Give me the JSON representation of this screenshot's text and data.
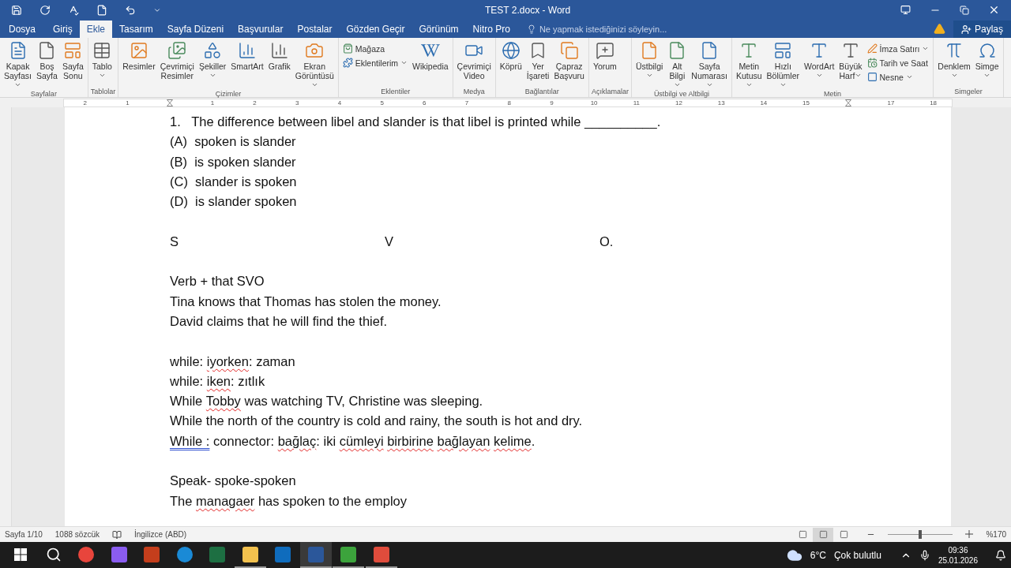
{
  "window": {
    "title": "TEST 2.docx - Word"
  },
  "tabs": [
    {
      "label": "Dosya",
      "selected": false
    },
    {
      "label": "Giriş",
      "selected": false
    },
    {
      "label": "Ekle",
      "selected": true
    },
    {
      "label": "Tasarım",
      "selected": false
    },
    {
      "label": "Sayfa Düzeni",
      "selected": false
    },
    {
      "label": "Başvurular",
      "selected": false
    },
    {
      "label": "Postalar",
      "selected": false
    },
    {
      "label": "Gözden Geçir",
      "selected": false
    },
    {
      "label": "Görünüm",
      "selected": false
    },
    {
      "label": "Nitro Pro",
      "selected": false
    }
  ],
  "tell_me": {
    "placeholder": "Ne yapmak istediğinizi söyleyin..."
  },
  "share": "Paylaş",
  "ribbon": {
    "groups": [
      {
        "label": "Sayfalar",
        "items": [
          {
            "kind": "large",
            "lines": [
              "Kapak",
              "Sayfası"
            ],
            "dropdown": true
          },
          {
            "kind": "large",
            "lines": [
              "Boş",
              "Sayfa"
            ],
            "dropdown": false
          },
          {
            "kind": "large",
            "lines": [
              "Sayfa",
              "Sonu"
            ],
            "dropdown": false
          }
        ]
      },
      {
        "label": "Tablolar",
        "items": [
          {
            "kind": "large",
            "lines": [
              "Tablo"
            ],
            "dropdown": true
          }
        ]
      },
      {
        "label": "Çizimler",
        "items": [
          {
            "kind": "large",
            "lines": [
              "Resimler"
            ],
            "dropdown": false
          },
          {
            "kind": "large",
            "lines": [
              "Çevrimiçi",
              "Resimler"
            ],
            "dropdown": false
          },
          {
            "kind": "large",
            "lines": [
              "Şekiller"
            ],
            "dropdown": true
          },
          {
            "kind": "large",
            "lines": [
              "SmartArt"
            ],
            "dropdown": false
          },
          {
            "kind": "large",
            "lines": [
              "Grafik"
            ],
            "dropdown": false
          },
          {
            "kind": "large",
            "lines": [
              "Ekran",
              "Görüntüsü"
            ],
            "dropdown": true
          }
        ]
      },
      {
        "label": "Eklentiler",
        "items": [
          {
            "kind": "small",
            "lines": [
              "Mağaza"
            ],
            "dropdown": false
          },
          {
            "kind": "small",
            "lines": [
              "Eklentilerim"
            ],
            "dropdown": true
          },
          {
            "kind": "large",
            "lines": [
              "Wikipedia"
            ],
            "dropdown": false
          }
        ]
      },
      {
        "label": "Medya",
        "items": [
          {
            "kind": "large",
            "lines": [
              "Çevrimiçi",
              "Video"
            ],
            "dropdown": false
          }
        ]
      },
      {
        "label": "Bağlantılar",
        "items": [
          {
            "kind": "large",
            "lines": [
              "Köprü"
            ],
            "dropdown": false
          },
          {
            "kind": "large",
            "lines": [
              "Yer",
              "İşareti"
            ],
            "dropdown": false
          },
          {
            "kind": "large",
            "lines": [
              "Çapraz",
              "Başvuru"
            ],
            "dropdown": false
          }
        ]
      },
      {
        "label": "Açıklamalar",
        "items": [
          {
            "kind": "large",
            "lines": [
              "Yorum"
            ],
            "dropdown": false
          }
        ]
      },
      {
        "label": "Üstbilgi ve Altbilgi",
        "items": [
          {
            "kind": "large",
            "lines": [
              "Üstbilgi"
            ],
            "dropdown": true
          },
          {
            "kind": "large",
            "lines": [
              "Alt",
              "Bilgi"
            ],
            "dropdown": true
          },
          {
            "kind": "large",
            "lines": [
              "Sayfa",
              "Numarası"
            ],
            "dropdown": true
          }
        ]
      },
      {
        "label": "Metin",
        "items": [
          {
            "kind": "large",
            "lines": [
              "Metin",
              "Kutusu"
            ],
            "dropdown": true
          },
          {
            "kind": "large",
            "lines": [
              "Hızlı",
              "Bölümler"
            ],
            "dropdown": true
          },
          {
            "kind": "large",
            "lines": [
              "WordArt"
            ],
            "dropdown": true
          },
          {
            "kind": "large",
            "lines": [
              "Büyük",
              "Harf"
            ],
            "dropdown": true
          },
          {
            "kind": "small",
            "lines": [
              "İmza Satırı"
            ],
            "dropdown": true
          },
          {
            "kind": "small",
            "lines": [
              "Tarih ve Saat"
            ],
            "dropdown": false
          },
          {
            "kind": "small",
            "lines": [
              "Nesne"
            ],
            "dropdown": true
          }
        ]
      },
      {
        "label": "Simgeler",
        "items": [
          {
            "kind": "large",
            "lines": [
              "Denklem"
            ],
            "dropdown": true
          },
          {
            "kind": "large",
            "lines": [
              "Simge"
            ],
            "dropdown": true
          }
        ]
      }
    ]
  },
  "ruler": [
    {
      "kind": "number",
      "label": "2"
    },
    {
      "kind": "number",
      "label": "1"
    },
    {
      "kind": "marker"
    },
    {
      "kind": "number",
      "label": "1"
    },
    {
      "kind": "number",
      "label": "2"
    },
    {
      "kind": "number",
      "label": "3"
    },
    {
      "kind": "number",
      "label": "4"
    },
    {
      "kind": "number",
      "label": "5"
    },
    {
      "kind": "number",
      "label": "6"
    },
    {
      "kind": "number",
      "label": "7"
    },
    {
      "kind": "number",
      "label": "8"
    },
    {
      "kind": "number",
      "label": "9"
    },
    {
      "kind": "number",
      "label": "10"
    },
    {
      "kind": "number",
      "label": "11"
    },
    {
      "kind": "number",
      "label": "12"
    },
    {
      "kind": "number",
      "label": "13"
    },
    {
      "kind": "number",
      "label": "14"
    },
    {
      "kind": "number",
      "label": "15"
    },
    {
      "kind": "marker"
    },
    {
      "kind": "number",
      "label": "17"
    },
    {
      "kind": "number",
      "label": "18"
    }
  ],
  "document": {
    "lines": [
      {
        "kind": "text",
        "segments": [
          {
            "text": "1.   The difference between libel and slander is that libel is printed while __________."
          }
        ]
      },
      {
        "kind": "text",
        "segments": [
          {
            "text": "(A)  spoken is slander"
          }
        ]
      },
      {
        "kind": "text",
        "segments": [
          {
            "text": "(B)  is spoken slander"
          }
        ]
      },
      {
        "kind": "text",
        "segments": [
          {
            "text": "(C)  slander is spoken"
          }
        ]
      },
      {
        "kind": "text",
        "segments": [
          {
            "text": "(D)  is slander spoken"
          }
        ]
      },
      {
        "kind": "blank"
      },
      {
        "kind": "columns",
        "cells": [
          "S",
          "V",
          "O."
        ]
      },
      {
        "kind": "blank"
      },
      {
        "kind": "text",
        "segments": [
          {
            "text": "Verb + that SVO"
          }
        ]
      },
      {
        "kind": "text",
        "segments": [
          {
            "text": "Tina knows that Thomas has stolen the money."
          }
        ]
      },
      {
        "kind": "text",
        "segments": [
          {
            "text": "David claims that he will find the thief."
          }
        ]
      },
      {
        "kind": "blank"
      },
      {
        "kind": "text",
        "segments": [
          {
            "text": "while: "
          },
          {
            "text": "iyorken",
            "spelling_error": true
          },
          {
            "text": ": zaman"
          }
        ]
      },
      {
        "kind": "text",
        "segments": [
          {
            "text": "while: "
          },
          {
            "text": "iken",
            "spelling_error": true
          },
          {
            "text": ": zıtlık"
          }
        ]
      },
      {
        "kind": "text",
        "segments": [
          {
            "text": "While "
          },
          {
            "text": "Tobby",
            "spelling_error": true
          },
          {
            "text": " was watching TV, Christine was sleeping."
          }
        ]
      },
      {
        "kind": "text",
        "segments": [
          {
            "text": "While the north of the country is cold and rainy, the south is hot and dry."
          }
        ]
      },
      {
        "kind": "text",
        "segments": [
          {
            "text": "While :",
            "grammar_error": true
          },
          {
            "text": " connector: "
          },
          {
            "text": "bağlaç",
            "spelling_error": true
          },
          {
            "text": ": iki "
          },
          {
            "text": "cümleyi",
            "spelling_error": true
          },
          {
            "text": " birbirine",
            "spelling_error": true
          },
          {
            "text": " bağlayan",
            "spelling_error": true
          },
          {
            "text": " kelime",
            "spelling_error": true
          },
          {
            "text": "."
          }
        ]
      },
      {
        "kind": "blank"
      },
      {
        "kind": "text",
        "segments": [
          {
            "text": "Speak- spoke-spoken"
          }
        ]
      },
      {
        "kind": "text",
        "segments": [
          {
            "text": "The "
          },
          {
            "text": "managaer",
            "spelling_error": true
          },
          {
            "text": " has spoken to the employ"
          }
        ]
      }
    ]
  },
  "status_bar": {
    "page": "Sayfa 1/10",
    "words": "1088 sözcük",
    "language": "İngilizce (ABD)",
    "views": [
      {
        "selected": false
      },
      {
        "selected": true
      },
      {
        "selected": false
      }
    ],
    "zoom": {
      "level": 0.5,
      "reading": "%170"
    }
  },
  "taskbar": {
    "apps": [
      {
        "kind": "chrome",
        "running": false
      },
      {
        "kind": "copilot",
        "running": false
      },
      {
        "kind": "powerpoint",
        "running": false
      },
      {
        "kind": "edge",
        "running": false
      },
      {
        "kind": "excel",
        "running": false
      },
      {
        "kind": "explorer",
        "running": true
      },
      {
        "kind": "outlook",
        "running": false
      },
      {
        "kind": "word",
        "running": true,
        "selected": true
      },
      {
        "kind": "camtasia",
        "running": true
      },
      {
        "kind": "recorder",
        "running": true
      }
    ],
    "temperature": "6°C",
    "weather": "Çok bulutlu",
    "time": "09:36",
    "date": "25.01.2026"
  }
}
